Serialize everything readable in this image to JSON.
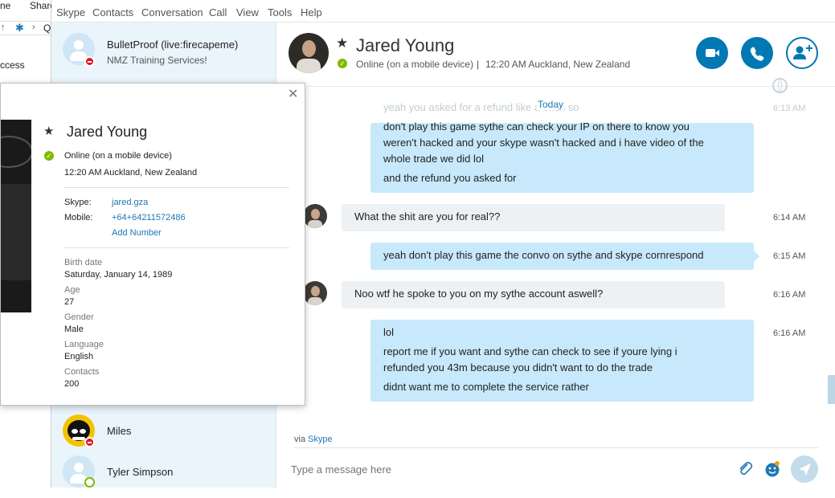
{
  "background_window": {
    "fragment_1": "ne",
    "fragment_2": "Share",
    "fragment_3": "Q",
    "fragment_4": "ccess"
  },
  "menu": [
    "Skype",
    "Contacts",
    "Conversation",
    "Call",
    "View",
    "Tools",
    "Help"
  ],
  "sidebar": {
    "top_contact": {
      "name": "BulletProof (live:firecapeme)",
      "status_text": "NMZ Training Services!"
    },
    "contacts": [
      {
        "name": "Miles"
      },
      {
        "name": "Tyler Simpson"
      }
    ]
  },
  "header": {
    "name": "Jared Young",
    "status": "Online (on a mobile device)",
    "separator": "|",
    "local_time": "12:20 AM Auckland, New Zealand"
  },
  "colors": {
    "accent": "#0078b4",
    "bubble_out": "#c7e9fb",
    "bubble_in": "#eef1f4",
    "online": "#7fba00",
    "dnd": "#e81123"
  },
  "profile_card": {
    "name": "Jared Young",
    "status": "Online (on a mobile device)",
    "local_time": "12:20 AM Auckland, New Zealand",
    "skype_label": "Skype:",
    "skype_value": "jared.gza",
    "mobile_label": "Mobile:",
    "mobile_value": "+64+64211572486",
    "add_number": "Add Number",
    "birth_label": "Birth date",
    "birth_value": "Saturday, January 14, 1989",
    "age_label": "Age",
    "age_value": "27",
    "gender_label": "Gender",
    "gender_value": "Male",
    "language_label": "Language",
    "language_value": "English",
    "contacts_label": "Contacts",
    "contacts_value": "200"
  },
  "conversation": {
    "day_divider": "Today",
    "faded_line": "yeah you asked for a refund like a bitch so",
    "faded_time": "6:13 AM",
    "messages": [
      {
        "from": "me",
        "lines": [
          "don't play this game sythe can check your IP on there to know you",
          "weren't hacked and your skype wasn't hacked and i have video of the",
          "whole trade we did lol",
          "and the refund you asked for"
        ],
        "time": ""
      },
      {
        "from": "them",
        "lines": [
          "What the shit are you for real??"
        ],
        "time": "6:14 AM"
      },
      {
        "from": "me",
        "lines": [
          "yeah don't play this game the convo on sythe and skype cornrespond"
        ],
        "time": "6:15 AM"
      },
      {
        "from": "them",
        "lines": [
          "Noo wtf he spoke to you on my sythe account aswell?"
        ],
        "time": "6:16 AM"
      },
      {
        "from": "me",
        "lines": [
          "lol",
          "report me if you want and sythe can check to see if youre lying i",
          "refunded you 43m because you didn't want to do the trade",
          "didnt want me to complete the service rather"
        ],
        "time": "6:16 AM"
      }
    ]
  },
  "composer": {
    "via_label": "via",
    "via_service": "Skype",
    "placeholder": "Type a message here"
  },
  "icons": [
    "video-call-icon",
    "phone-call-icon",
    "add-person-icon",
    "globe-icon",
    "attach-icon",
    "emoticon-icon",
    "send-icon",
    "close-icon",
    "star-icon",
    "online-check-icon"
  ]
}
